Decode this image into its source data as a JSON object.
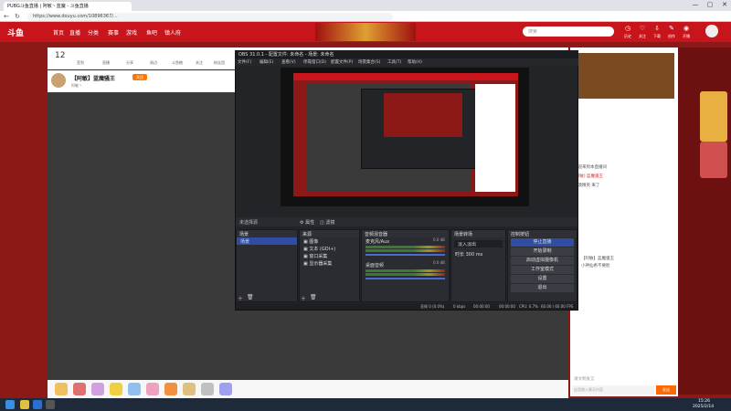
{
  "browser": {
    "tab_title": "PUBG斗鱼直播 | 阿敏丶蓝魔  - 斗鱼直播",
    "url": "https://www.douyu.com/10896367/...",
    "window_controls": [
      "—",
      "▢",
      "✕"
    ]
  },
  "site": {
    "logo": "斗鱼",
    "nav": [
      "首页",
      "直播",
      "分类",
      "赛事",
      "游戏",
      "鱼吧",
      "镇人府"
    ],
    "search_placeholder": "搜索",
    "header_icons": [
      "历史",
      "关注",
      "下载",
      "创作",
      "开播"
    ]
  },
  "room": {
    "level_badge": "12",
    "title": "【阿敏】蓝魔骚王",
    "follow_label": "关注",
    "anchor": "阿敏丶",
    "toolbar_items": [
      "签到",
      "直播",
      "分享",
      "周边",
      "斗鱼粮",
      "关注",
      "粉丝团"
    ],
    "rank_label": "PCB排行榜"
  },
  "obs": {
    "title": "OBS 31.0.1 - 配置文件: 未命名 - 场景: 未命名",
    "menu": [
      "文件(F)",
      "编辑(E)",
      "查看(V)",
      "停靠窗口(D)",
      "配置文件(P)",
      "场景集合(S)",
      "工具(T)",
      "帮助(H)"
    ],
    "audio_source_bar": "未选择源",
    "props_label": "属性",
    "filters_label": "滤镜",
    "docks": {
      "scenes": {
        "title": "场景",
        "items": [
          "场景"
        ]
      },
      "sources": {
        "title": "来源",
        "items": [
          "图像",
          "文本 (GDI+)",
          "窗口采集",
          "显示器采集"
        ]
      },
      "mixer": {
        "title": "音频混音器",
        "channels": [
          {
            "name": "麦克风/Aux",
            "db": "0.0 dB"
          },
          {
            "name": "桌面音频",
            "db": "0.0 dB"
          }
        ]
      },
      "transitions": {
        "title": "场景转场",
        "type": "淡入淡出",
        "duration_label": "时长",
        "duration": "300 ms"
      },
      "controls": {
        "title": "控制按钮",
        "buttons": [
          "停止直播",
          "开始录制",
          "启动虚拟摄像机",
          "工作室模式",
          "设置",
          "退出"
        ]
      }
    },
    "status": {
      "drops": "丢帧 0 (0.0%)",
      "bitrate": "0 kbps",
      "time1": "00:00:00",
      "time2": "00:00:00",
      "cpu": "CPU: 0.7%",
      "fps": "60.00 / 60.00 FPS"
    }
  },
  "chat": {
    "messages": [
      "欢迎来到本直播间",
      "[阿敏] 蓝魔骚王",
      "沙漠精英 来了",
      "【阿敏】蓝魔骚王",
      "小神仙希不要脸",
      "请文明发言"
    ],
    "input_placeholder": "这里输入聊天内容",
    "send_label": "发送"
  },
  "taskbar": {
    "time": "15:26",
    "date": "2025/2/14"
  },
  "colors": {
    "brand": "#c8141b",
    "obs_bg": "#232428",
    "obs_accent": "#2f4ea3"
  }
}
